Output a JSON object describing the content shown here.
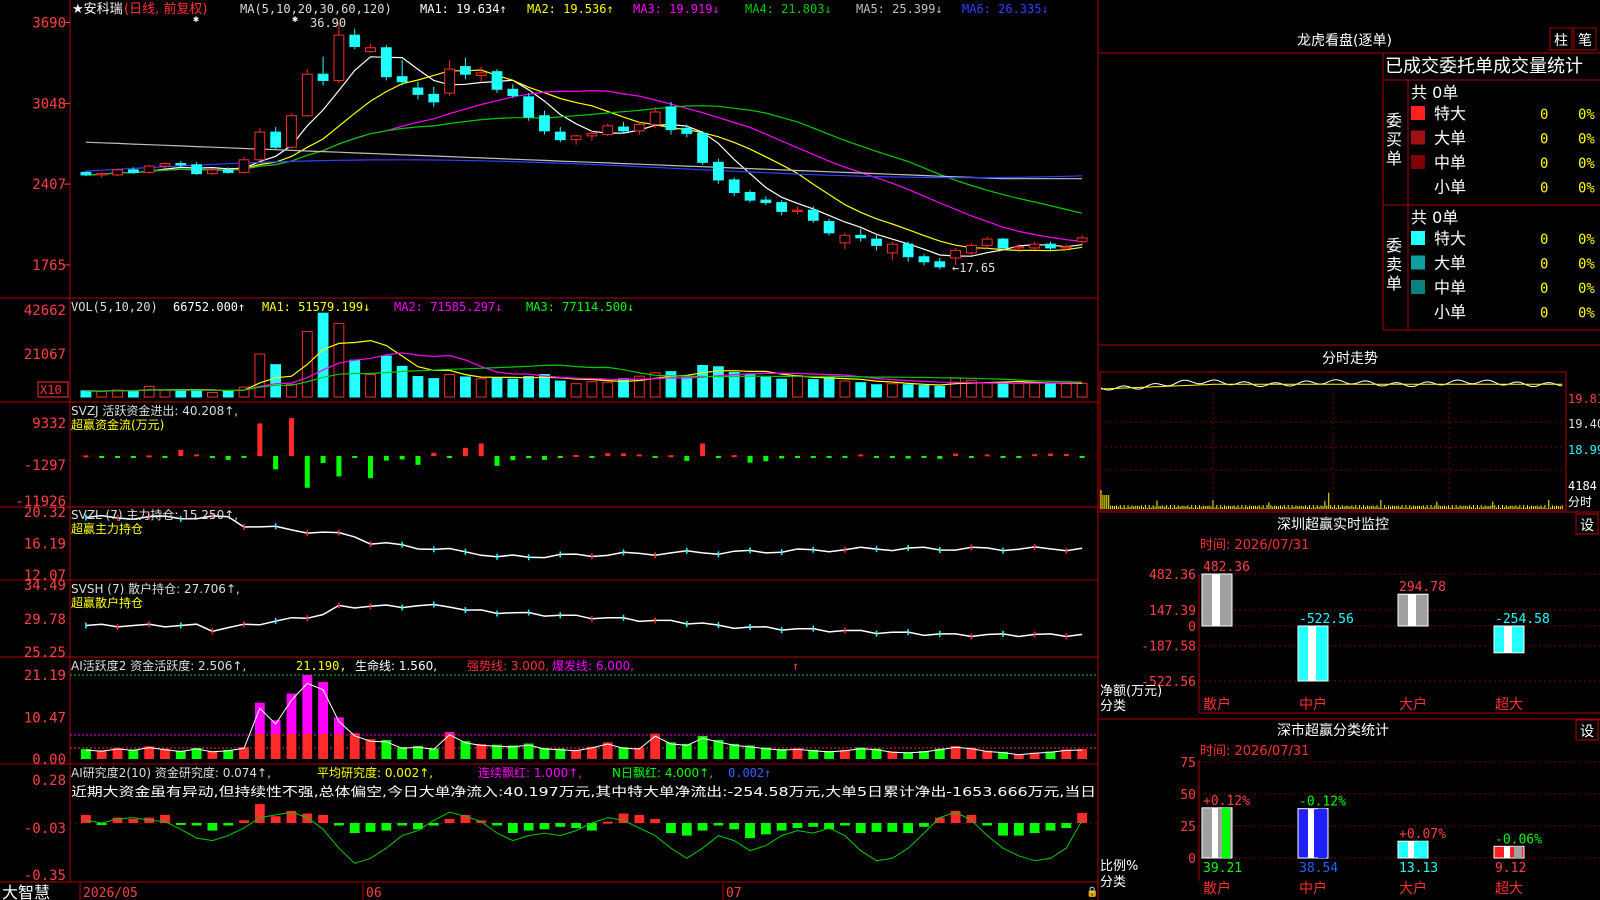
{
  "app": {
    "title": "大智慧",
    "stock_name": "★安科瑞",
    "period": "(日线, 前复权)"
  },
  "colors": {
    "up": "#ff2a2a",
    "down": "#22ffff",
    "ma1": "#ffffff",
    "ma2": "#ffff00",
    "ma3": "#ff00ff",
    "ma4": "#00cc00",
    "ma5": "#c0c0c0",
    "ma6": "#3040ff",
    "frame": "#b00000",
    "grid": "#7a0000",
    "label": "#ff4040",
    "green": "#00ff00",
    "yellow": "#ffff00",
    "magenta": "#ff00ff",
    "white": "#ffffff"
  },
  "panels": {
    "price": {
      "header": "MA(5,10,20,30,60,120)",
      "ma": [
        {
          "name": "MA1:",
          "value": "19.634↑",
          "color": "#ffffff"
        },
        {
          "name": "MA2:",
          "value": "19.536↑",
          "color": "#ffff00"
        },
        {
          "name": "MA3:",
          "value": "19.919↓",
          "color": "#ff00ff"
        },
        {
          "name": "MA4:",
          "value": "21.803↓",
          "color": "#00cc00"
        },
        {
          "name": "MA5:",
          "value": "25.399↓",
          "color": "#c0c0c0"
        },
        {
          "name": "MA6:",
          "value": "26.335↓",
          "color": "#3040ff"
        }
      ],
      "yticks": [
        "3690",
        "3048",
        "2407",
        "1765"
      ],
      "high_label": "36.90",
      "low_label": "←17.65"
    },
    "vol": {
      "header": "VOL(5,10,20)",
      "value": "66752.000↑",
      "ma1": "MA1: 51579.199↓",
      "ma2": "MA2: 71585.297↓",
      "ma3": "MA3: 77114.500↓",
      "yticks": [
        "42662",
        "21067"
      ],
      "unit": "X10"
    },
    "svzj": {
      "header": "SVZJ  活跃资金进出: 40.208↑,",
      "sub": "超赢资金流(万元)",
      "yticks": [
        "9332",
        "-1297",
        "-11926"
      ]
    },
    "svzl": {
      "header": "SVZL (7) 主力持仓: 15.250↑,",
      "sub": "超赢主力持仓",
      "yticks": [
        "20.32",
        "16.19",
        "12.07"
      ]
    },
    "svsh": {
      "header": "SVSH (7) 散户持仓: 27.706↑,",
      "sub": "超赢散户持仓",
      "yticks": [
        "34.49",
        "29.78",
        "25.25"
      ]
    },
    "ai1": {
      "header": "AI活跃度2 资金活跃度: 2.506↑,",
      "v2": "21.190,",
      "v3": "生命线: 1.560,",
      "v4": "强势线: 3.000,",
      "v5": "爆发线: 6.000,",
      "yticks": [
        "21.19",
        "10.47",
        "0.00"
      ]
    },
    "ai2": {
      "header": "AI研究度2(10) 资金研究度: 0.074↑,",
      "v2": "平均研究度: 0.002↑,",
      "v3": "连续飘红: 1.000↑,",
      "v4": "N日飘红: 4.000↑,",
      "v5": "0.002↑",
      "yticks": [
        "0.28",
        "-0.03",
        "-0.35"
      ],
      "note": "近期大资金虽有异动,但持续性不强,总体偏空,今日大单净流入:40.197万元,其中特大单净流出:-254.58万元,大单5日累计净出-1653.666万元,当日"
    }
  },
  "xaxis": {
    "labels": [
      "2026/05",
      "06",
      "07"
    ]
  },
  "right": {
    "lhb": {
      "title": "龙虎看盘(逐单)",
      "btn1": "柱",
      "btn2": "笔",
      "subtitle": "已成交委托单成交量统计",
      "buy_side": "委买单",
      "sell_side": "委卖单",
      "buy_total": "共 0单",
      "sell_total": "共 0单",
      "rows": [
        {
          "label": "特大",
          "count": "0",
          "pct": "0%"
        },
        {
          "label": "大单",
          "count": "0",
          "pct": "0%"
        },
        {
          "label": "中单",
          "count": "0",
          "pct": "0%"
        },
        {
          "label": "小单",
          "count": "0",
          "pct": "0%"
        }
      ]
    },
    "fenshi": {
      "title": "分时走势",
      "yticks": [
        "19.81",
        "19.40",
        "18.99"
      ],
      "vol": "4184",
      "unit": "分时"
    },
    "monitor": {
      "title": "深圳超赢实时监控",
      "btn": "设",
      "time": "时间: 2026/07/31",
      "ylabel": "净额(万元)",
      "xlabel": "分类",
      "yticks": [
        "482.36",
        "147.39",
        "0",
        "-187.58",
        "-522.56"
      ],
      "categories": [
        "散户",
        "中户",
        "大户",
        "超大"
      ],
      "values": [
        482.36,
        -522.56,
        294.78,
        -254.58
      ],
      "value_labels": [
        "482.36",
        "-522.56",
        "294.78",
        "-254.58"
      ]
    },
    "classify": {
      "title": "深市超赢分类统计",
      "btn": "设",
      "time": "时间: 2026/07/31",
      "ylabel": "比例%",
      "xlabel": "分类",
      "yticks": [
        "75",
        "50",
        "25",
        "0"
      ],
      "categories": [
        "散户",
        "中户",
        "大户",
        "超大"
      ],
      "values": [
        39.21,
        38.54,
        13.13,
        9.12
      ],
      "value_labels": [
        "39.21",
        "38.54",
        "13.13",
        "9.12"
      ],
      "delta_labels": [
        "+0.12%",
        "-0.12%",
        "+0.07%",
        "-0.06%"
      ]
    }
  },
  "chart_data": [
    {
      "type": "candlestick",
      "title": "安科瑞 日线 前复权",
      "x_labels": [
        "2026/05",
        "06",
        "07"
      ],
      "ylim": [
        15.5,
        37.5
      ],
      "ohlc": [
        [
          25.0,
          25.1,
          24.7,
          24.8
        ],
        [
          24.8,
          25.0,
          24.6,
          24.9
        ],
        [
          24.8,
          25.3,
          24.7,
          25.2
        ],
        [
          25.2,
          25.4,
          24.9,
          25.0
        ],
        [
          25.0,
          25.6,
          24.9,
          25.5
        ],
        [
          25.5,
          25.8,
          25.3,
          25.7
        ],
        [
          25.7,
          25.9,
          25.4,
          25.6
        ],
        [
          25.6,
          25.8,
          24.8,
          24.9
        ],
        [
          24.9,
          25.3,
          24.8,
          25.2
        ],
        [
          25.2,
          25.4,
          24.9,
          25.0
        ],
        [
          25.0,
          26.2,
          24.9,
          26.0
        ],
        [
          26.0,
          28.5,
          25.9,
          28.2
        ],
        [
          28.2,
          28.6,
          26.8,
          27.0
        ],
        [
          27.0,
          29.7,
          26.9,
          29.5
        ],
        [
          29.5,
          33.2,
          29.4,
          32.8
        ],
        [
          32.8,
          34.2,
          31.9,
          32.3
        ],
        [
          32.3,
          36.9,
          32.1,
          35.9
        ],
        [
          35.9,
          36.4,
          34.8,
          35.0
        ],
        [
          34.6,
          35.2,
          34.5,
          34.9
        ],
        [
          34.9,
          35.1,
          32.3,
          32.6
        ],
        [
          32.6,
          33.9,
          31.9,
          32.2
        ],
        [
          31.7,
          32.2,
          30.8,
          31.2
        ],
        [
          31.2,
          31.8,
          30.2,
          30.6
        ],
        [
          31.3,
          33.9,
          31.1,
          33.2
        ],
        [
          33.4,
          34.1,
          32.4,
          32.8
        ],
        [
          32.7,
          33.4,
          32.2,
          32.9
        ],
        [
          33.0,
          33.2,
          31.3,
          31.6
        ],
        [
          31.6,
          32.0,
          30.9,
          31.1
        ],
        [
          31.0,
          31.3,
          29.1,
          29.4
        ],
        [
          29.5,
          29.9,
          28.0,
          28.3
        ],
        [
          28.2,
          28.6,
          27.4,
          27.6
        ],
        [
          27.6,
          28.0,
          27.2,
          27.9
        ],
        [
          27.9,
          28.3,
          27.5,
          28.1
        ],
        [
          28.0,
          28.9,
          27.9,
          28.7
        ],
        [
          28.6,
          29.0,
          28.1,
          28.3
        ],
        [
          28.3,
          29.0,
          28.0,
          28.8
        ],
        [
          28.8,
          30.2,
          28.5,
          29.8
        ],
        [
          30.2,
          30.6,
          28.0,
          28.4
        ],
        [
          28.5,
          28.8,
          27.8,
          28.1
        ],
        [
          28.1,
          28.3,
          25.6,
          25.8
        ],
        [
          25.8,
          26.1,
          24.1,
          24.4
        ],
        [
          24.4,
          24.6,
          23.1,
          23.4
        ],
        [
          23.4,
          23.6,
          22.6,
          22.8
        ],
        [
          22.8,
          23.1,
          22.4,
          22.6
        ],
        [
          22.6,
          22.8,
          21.6,
          21.9
        ],
        [
          21.9,
          22.3,
          21.7,
          22.0
        ],
        [
          22.0,
          22.3,
          21.0,
          21.2
        ],
        [
          21.1,
          21.3,
          20.0,
          20.2
        ],
        [
          19.4,
          20.2,
          18.9,
          20.0
        ],
        [
          20.0,
          20.5,
          19.5,
          19.8
        ],
        [
          19.7,
          20.1,
          18.8,
          19.2
        ],
        [
          18.6,
          19.5,
          18.0,
          19.3
        ],
        [
          19.3,
          19.5,
          17.9,
          18.3
        ],
        [
          18.3,
          18.5,
          17.6,
          17.9
        ],
        [
          17.9,
          18.2,
          17.3,
          17.5
        ],
        [
          18.2,
          19.0,
          17.65,
          18.8
        ],
        [
          18.6,
          19.4,
          18.4,
          19.2
        ],
        [
          19.2,
          19.9,
          18.9,
          19.7
        ],
        [
          19.7,
          19.8,
          18.9,
          19.0
        ],
        [
          19.0,
          19.3,
          18.7,
          19.1
        ],
        [
          19.0,
          19.5,
          18.9,
          19.3
        ],
        [
          19.3,
          19.5,
          18.8,
          19.0
        ],
        [
          19.0,
          19.3,
          18.8,
          19.1
        ],
        [
          19.5,
          20.0,
          19.2,
          19.8
        ]
      ],
      "ma_series": [
        "MA1",
        "MA2",
        "MA3",
        "MA4",
        "MA5",
        "MA6"
      ]
    },
    {
      "type": "bar",
      "title": "VOL(5,10,20)",
      "ylim": [
        0,
        45000
      ],
      "values": [
        3000,
        2800,
        3400,
        2900,
        5200,
        3300,
        3100,
        3500,
        2200,
        3100,
        4800,
        21000,
        15800,
        6200,
        32000,
        41000,
        36000,
        18000,
        11000,
        20000,
        15000,
        10000,
        9000,
        11000,
        9800,
        8900,
        9500,
        8700,
        10000,
        11000,
        7800,
        6500,
        7500,
        7200,
        8900,
        10200,
        11800,
        12400,
        9600,
        15400,
        14800,
        12000,
        10800,
        9600,
        8700,
        10500,
        8500,
        9500,
        7800,
        7000,
        6000,
        6500,
        6000,
        5600,
        5200,
        9200,
        8200,
        7000,
        6900,
        6600,
        7000,
        6700,
        6500,
        6675
      ]
    },
    {
      "type": "bar",
      "title": "SVZJ 超赢资金流",
      "ylim": [
        -11926,
        9332
      ],
      "values": [
        150,
        -180,
        -120,
        -220,
        150,
        -200,
        1500,
        400,
        -600,
        -1100,
        -200,
        8000,
        -3800,
        9300,
        -9000,
        -2000,
        -5800,
        -200,
        -6300,
        -1300,
        -1000,
        -2500,
        800,
        -300,
        2000,
        3100,
        -2800,
        -1200,
        -600,
        -1100,
        -250,
        250,
        -150,
        700,
        650,
        400,
        -200,
        200,
        -1400,
        3100,
        -600,
        200,
        -1900,
        -1500,
        -700,
        -400,
        -500,
        -300,
        -500,
        400,
        -200,
        -300,
        -700,
        -400,
        -800,
        600,
        -300,
        400,
        -200,
        -200,
        450,
        600,
        500,
        -200
      ]
    },
    {
      "type": "line",
      "title": "SVZL 超赢主力持仓",
      "ylim": [
        12.07,
        20.32
      ]
    },
    {
      "type": "line",
      "title": "SVSH 超赢散户持仓",
      "ylim": [
        25.25,
        34.49
      ]
    },
    {
      "type": "bar",
      "title": "AI活跃度2",
      "ylim": [
        0,
        21.19
      ]
    },
    {
      "type": "bar",
      "title": "AI研究度2(10)",
      "ylim": [
        -0.35,
        0.28
      ]
    },
    {
      "type": "bar",
      "title": "深圳超赢实时监控",
      "categories": [
        "散户",
        "中户",
        "大户",
        "超大"
      ],
      "values": [
        482.36,
        -522.56,
        294.78,
        -254.58
      ],
      "ylim": [
        -522.56,
        482.36
      ]
    },
    {
      "type": "bar",
      "title": "深市超赢分类统计",
      "categories": [
        "散户",
        "中户",
        "大户",
        "超大"
      ],
      "values": [
        39.21,
        38.54,
        13.13,
        9.12
      ],
      "ylim": [
        0,
        75
      ]
    }
  ]
}
